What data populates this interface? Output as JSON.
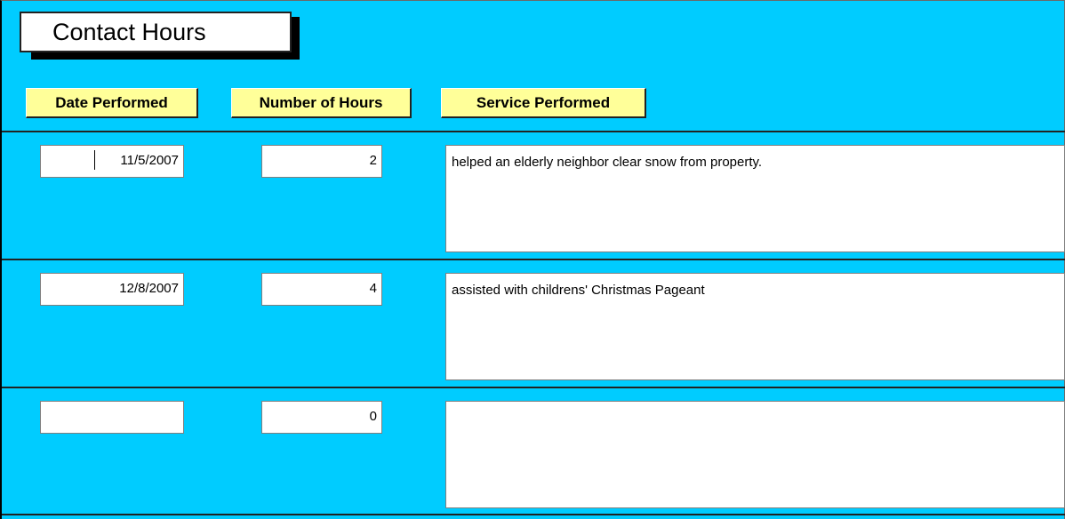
{
  "form": {
    "title": "Contact Hours",
    "colors": {
      "background": "#00CCFF",
      "header_fill": "#FFFF99",
      "field_fill": "#FFFFFF"
    }
  },
  "columns": {
    "date": "Date Performed",
    "hours": "Number of Hours",
    "service": "Service Performed"
  },
  "rows": [
    {
      "date": "11/5/2007",
      "hours": "2",
      "service": "helped an elderly neighbor clear snow from property."
    },
    {
      "date": "12/8/2007",
      "hours": "4",
      "service": "assisted with childrens' Christmas Pageant"
    },
    {
      "date": "",
      "hours": "0",
      "service": ""
    }
  ]
}
